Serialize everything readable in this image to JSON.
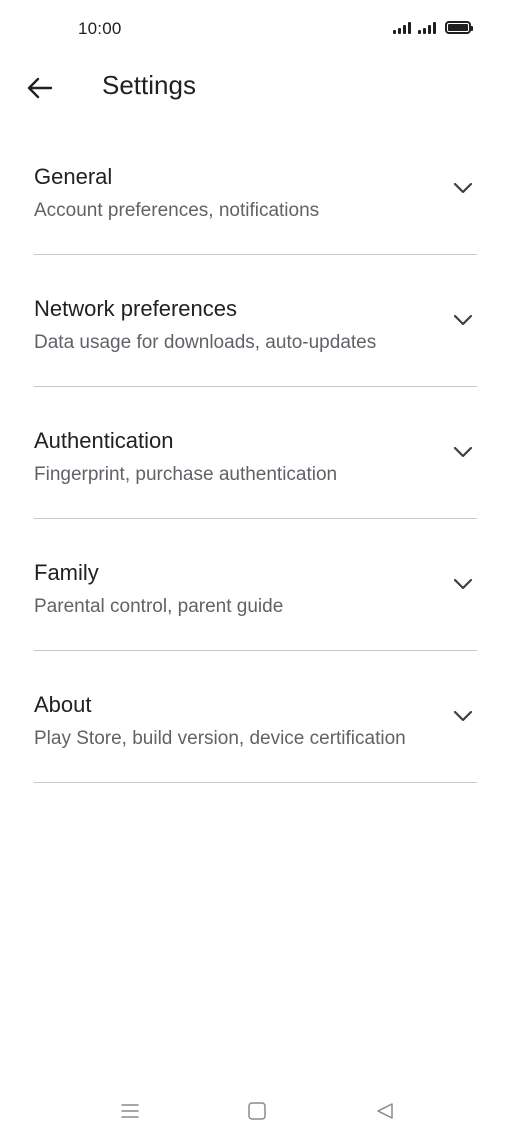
{
  "status_bar": {
    "time": "10:00",
    "icons": [
      "signal-icon",
      "signal-icon",
      "battery-icon"
    ]
  },
  "app_bar": {
    "back_icon": "arrow-back-icon",
    "title": "Settings"
  },
  "settings": {
    "items": [
      {
        "title": "General",
        "subtitle": "Account preferences, notifications",
        "icon": "chevron-down-icon"
      },
      {
        "title": "Network preferences",
        "subtitle": "Data usage for downloads, auto-updates",
        "icon": "chevron-down-icon"
      },
      {
        "title": "Authentication",
        "subtitle": "Fingerprint, purchase authentication",
        "icon": "chevron-down-icon"
      },
      {
        "title": "Family",
        "subtitle": "Parental control, parent guide",
        "icon": "chevron-down-icon"
      },
      {
        "title": "About",
        "subtitle": "Play Store, build version, device certification",
        "icon": "chevron-down-icon"
      }
    ]
  },
  "nav_bar": {
    "icons": [
      "menu-icon",
      "home-icon",
      "back-triangle-icon"
    ]
  },
  "colors": {
    "background": "#ffffff",
    "title_text": "#202124",
    "subtitle_text": "#5f6368",
    "divider": "#c8c8c8"
  }
}
